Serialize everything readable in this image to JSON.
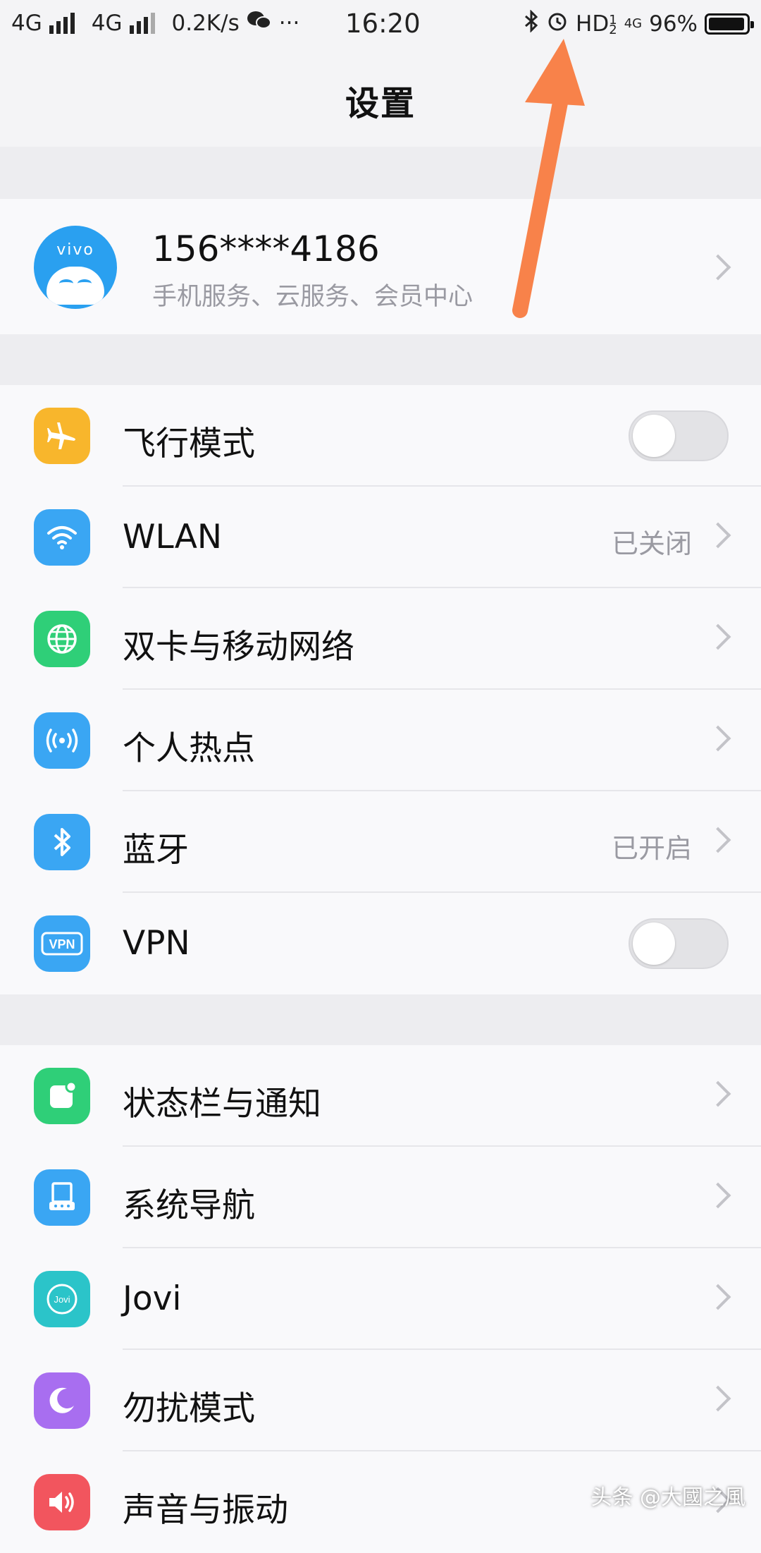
{
  "status_bar": {
    "net1": "4G",
    "net2": "4G",
    "speed": "0.2K/s",
    "more": "···",
    "time": "16:20",
    "hd": "HD",
    "hd_sup": "1",
    "hd_sub": "2",
    "net3": "4G",
    "battery_percent_text": "96%",
    "battery_level": 0.96
  },
  "header": {
    "title": "设置"
  },
  "account": {
    "avatar_brand": "vivo",
    "name": "156****4186",
    "subtitle": "手机服务、云服务、会员中心"
  },
  "group1": [
    {
      "label": "飞行模式",
      "icon": "airplane-icon",
      "color": "#f8b62c",
      "control": "toggle",
      "value": "",
      "on": false
    },
    {
      "label": "WLAN",
      "icon": "wifi-icon",
      "color": "#3aa6f3",
      "control": "chevron",
      "value": "已关闭"
    },
    {
      "label": "双卡与移动网络",
      "icon": "globe-icon",
      "color": "#2fcf78",
      "control": "chevron",
      "value": ""
    },
    {
      "label": "个人热点",
      "icon": "hotspot-icon",
      "color": "#3aa6f3",
      "control": "chevron",
      "value": ""
    },
    {
      "label": "蓝牙",
      "icon": "bluetooth-icon",
      "color": "#3aa6f3",
      "control": "chevron",
      "value": "已开启"
    },
    {
      "label": "VPN",
      "icon": "vpn-icon",
      "color": "#3aa6f3",
      "control": "toggle",
      "value": "",
      "on": false
    }
  ],
  "group2": [
    {
      "label": "状态栏与通知",
      "icon": "notification-icon",
      "color": "#2fcf78",
      "control": "chevron",
      "value": ""
    },
    {
      "label": "系统导航",
      "icon": "navigation-icon",
      "color": "#3aa6f3",
      "control": "chevron",
      "value": ""
    },
    {
      "label": "Jovi",
      "icon": "jovi-icon",
      "color": "#2bc4c9",
      "control": "chevron",
      "value": ""
    },
    {
      "label": "勿扰模式",
      "icon": "moon-icon",
      "color": "#a86ef0",
      "control": "chevron",
      "value": ""
    },
    {
      "label": "声音与振动",
      "icon": "speaker-icon",
      "color": "#f2555e",
      "control": "chevron",
      "value": ""
    }
  ],
  "watermark": "头条 @大國之風",
  "annotation_color": "#f8824a"
}
